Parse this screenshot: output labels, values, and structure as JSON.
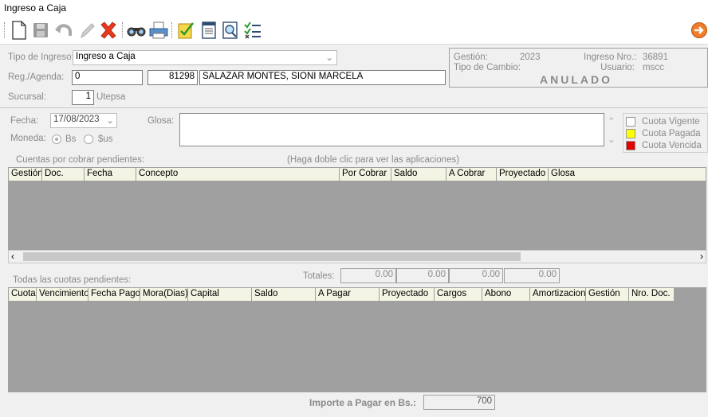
{
  "window": {
    "title": "Ingreso a Caja"
  },
  "toolbar": {
    "icons": [
      "new-icon",
      "save-icon",
      "undo-icon",
      "edit-icon",
      "delete-icon",
      "search-icon",
      "print-icon",
      "approve-icon",
      "notepad-icon",
      "preview-icon",
      "checklist-icon",
      "exit-icon"
    ]
  },
  "form": {
    "tipo_ingreso_label": "Tipo de Ingreso:",
    "tipo_ingreso_value": "Ingreso a Caja",
    "reg_agenda_label": "Reg./Agenda:",
    "reg_agenda_value": "0",
    "cliente_code": "81298",
    "cliente_name": "SALAZAR MONTES, SIONI MARCELA",
    "sucursal_label": "Sucursal:",
    "sucursal_value": "1",
    "sucursal_name": "Utepsa",
    "fecha_label": "Fecha:",
    "fecha_value": "17/08/2023",
    "glosa_label": "Glosa:",
    "glosa_value": "",
    "moneda_label": "Moneda:",
    "moneda_bs": "Bs",
    "moneda_sus": "$us"
  },
  "info": {
    "gestion_label": "Gestión:",
    "gestion_value": "2023",
    "tipo_cambio_label": "Tipo de Cambio:",
    "ingreso_nro_label": "Ingreso Nro.:",
    "ingreso_nro_value": "36891",
    "usuario_label": "Usuario:",
    "usuario_value": "mscc",
    "status": "ANULADO"
  },
  "legend": {
    "items": [
      {
        "label": "Cuota Vigente",
        "color": "#ffffff"
      },
      {
        "label": "Cuota Pagada",
        "color": "#ffff00"
      },
      {
        "label": "Cuota Vencida",
        "color": "#e00000"
      }
    ]
  },
  "grid1": {
    "caption": "Cuentas por cobrar pendientes:",
    "hint": "(Haga doble clic para ver las aplicaciones)",
    "columns": [
      "Gestión",
      "Doc.",
      "Fecha",
      "Concepto",
      "Por Cobrar",
      "Saldo",
      "A Cobrar",
      "Proyectado",
      "Glosa"
    ]
  },
  "grid2": {
    "caption": "Todas las cuotas pendientes:",
    "totales_label": "Totales:",
    "totales": [
      "0.00",
      "0.00",
      "0.00",
      "0.00"
    ],
    "columns": [
      "Cuota",
      "Vencimiento",
      "Fecha Pago",
      "Mora(Dias)",
      "Capital",
      "Saldo",
      "A Pagar",
      "Proyectado",
      "Cargos",
      "Abono",
      "Amortizacion",
      "Gestión",
      "Nro. Doc."
    ]
  },
  "footer": {
    "importe_label": "Importe a Pagar en Bs.:",
    "importe_value": "700"
  },
  "colors": {
    "status": "#8a8a8a",
    "grid_bg": "#a0a0a0",
    "header_bg": "#f4f4e4"
  }
}
